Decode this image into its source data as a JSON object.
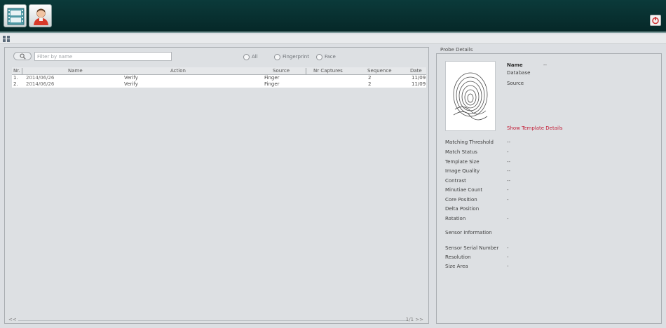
{
  "toolbar": {
    "icons": [
      "film-icon",
      "user-icon"
    ],
    "power_icon": "power-icon",
    "accent": "#062828"
  },
  "subbar": {
    "icon": "grid-icon"
  },
  "left_panel": {
    "search": {
      "placeholder": "Filter by name"
    },
    "filters": [
      "All",
      "Fingerprint",
      "Face"
    ],
    "columns": [
      "Nr.",
      "Name",
      "Action",
      "Source",
      "Nr Captures",
      "Sequence",
      "Date"
    ],
    "rows": [
      [
        "1.",
        "2014/06/26",
        "Verify",
        "Finger",
        "2",
        "11/09"
      ],
      [
        "2.",
        "2014/06/26",
        "Verify",
        "Finger",
        "2",
        "11/09"
      ]
    ],
    "footer_left": "<<",
    "footer_right": "1/1 >>"
  },
  "right_panel": {
    "title": "Probe Details",
    "header_info": [
      {
        "label": "Name",
        "value": "--"
      },
      {
        "label": "Database",
        "value": ""
      },
      {
        "label": "Source",
        "value": ""
      }
    ],
    "link": "Show Template Details",
    "fields": [
      {
        "label": "Matching Threshold",
        "value": "--"
      },
      {
        "label": "Match Status",
        "value": "-"
      },
      {
        "label": "Template Size",
        "value": "--"
      },
      {
        "label": "Image Quality",
        "value": "--"
      },
      {
        "label": "Contrast",
        "value": "--"
      },
      {
        "label": "Minutiae Count",
        "value": "-"
      },
      {
        "label": "Core Position",
        "value": "-"
      },
      {
        "label": "Delta Position",
        "value": ""
      },
      {
        "label": "Rotation",
        "value": "-"
      }
    ],
    "section": "Sensor Information",
    "sensor_fields": [
      {
        "label": "Sensor Serial Number",
        "value": "-"
      },
      {
        "label": "Resolution",
        "value": "-"
      },
      {
        "label": "Size Area",
        "value": "-"
      }
    ],
    "colors": {
      "link": "#c4213a"
    }
  }
}
